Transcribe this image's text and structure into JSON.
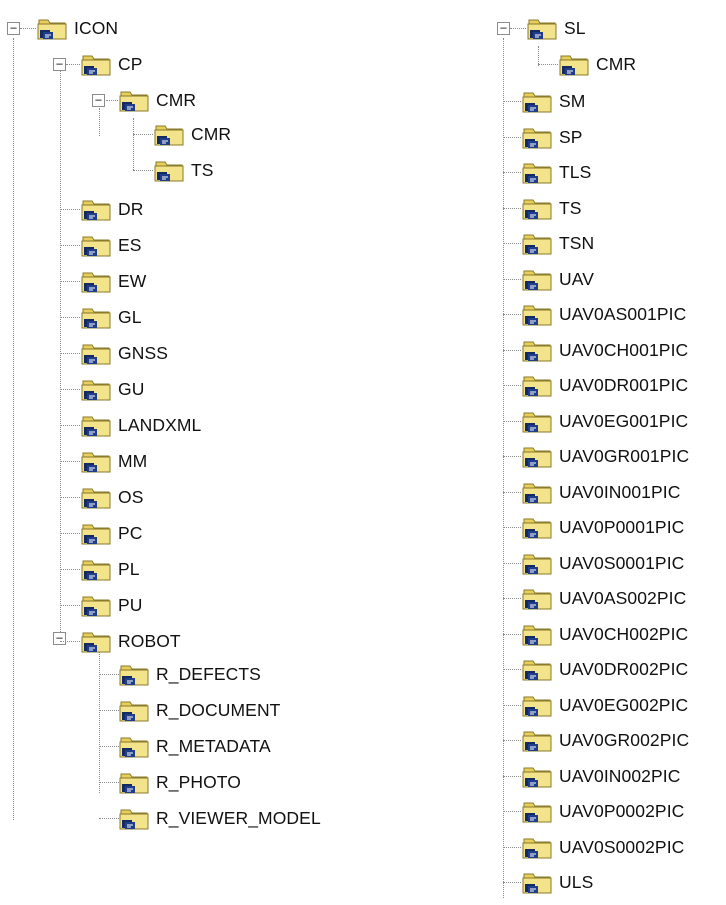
{
  "tree": {
    "left_root": {
      "label": "ICON",
      "children": [
        {
          "label": "CP",
          "children": [
            {
              "label": "CMR",
              "children": [
                {
                  "label": "CMR"
                },
                {
                  "label": "TS"
                }
              ]
            }
          ]
        },
        {
          "label": "DR"
        },
        {
          "label": "ES"
        },
        {
          "label": "EW"
        },
        {
          "label": "GL"
        },
        {
          "label": "GNSS"
        },
        {
          "label": "GU"
        },
        {
          "label": "LANDXML"
        },
        {
          "label": "MM"
        },
        {
          "label": "OS"
        },
        {
          "label": "PC"
        },
        {
          "label": "PL"
        },
        {
          "label": "PU"
        },
        {
          "label": "ROBOT",
          "children": [
            {
              "label": "R_DEFECTS"
            },
            {
              "label": "R_DOCUMENT"
            },
            {
              "label": "R_METADATA"
            },
            {
              "label": "R_PHOTO"
            },
            {
              "label": "R_VIEWER_MODEL"
            }
          ]
        }
      ]
    },
    "right_items": [
      {
        "label": "SL",
        "children": [
          {
            "label": "CMR"
          }
        ]
      },
      {
        "label": "SM"
      },
      {
        "label": "SP"
      },
      {
        "label": "TLS"
      },
      {
        "label": "TS"
      },
      {
        "label": "TSN"
      },
      {
        "label": "UAV"
      },
      {
        "label": "UAV0AS001PIC"
      },
      {
        "label": "UAV0CH001PIC"
      },
      {
        "label": "UAV0DR001PIC"
      },
      {
        "label": "UAV0EG001PIC"
      },
      {
        "label": "UAV0GR001PIC"
      },
      {
        "label": "UAV0IN001PIC"
      },
      {
        "label": "UAV0P0001PIC"
      },
      {
        "label": "UAV0S0001PIC"
      },
      {
        "label": "UAV0AS002PIC"
      },
      {
        "label": "UAV0CH002PIC"
      },
      {
        "label": "UAV0DR002PIC"
      },
      {
        "label": "UAV0EG002PIC"
      },
      {
        "label": "UAV0GR002PIC"
      },
      {
        "label": "UAV0IN002PIC"
      },
      {
        "label": "UAV0P0002PIC"
      },
      {
        "label": "UAV0S0002PIC"
      },
      {
        "label": "ULS"
      }
    ],
    "expanded_glyph": "−"
  },
  "colors": {
    "folder_body": "#f3e38a",
    "folder_tab": "#e8cf5c",
    "folder_outline": "#8a7a2a",
    "overlay_blue": "#1f3d8a",
    "overlay_dark": "#142a63",
    "connector": "#8a8a8a"
  },
  "icons": {
    "folder": "folder-with-network-overlay-icon",
    "toggle": "collapse-toggle-icon"
  }
}
